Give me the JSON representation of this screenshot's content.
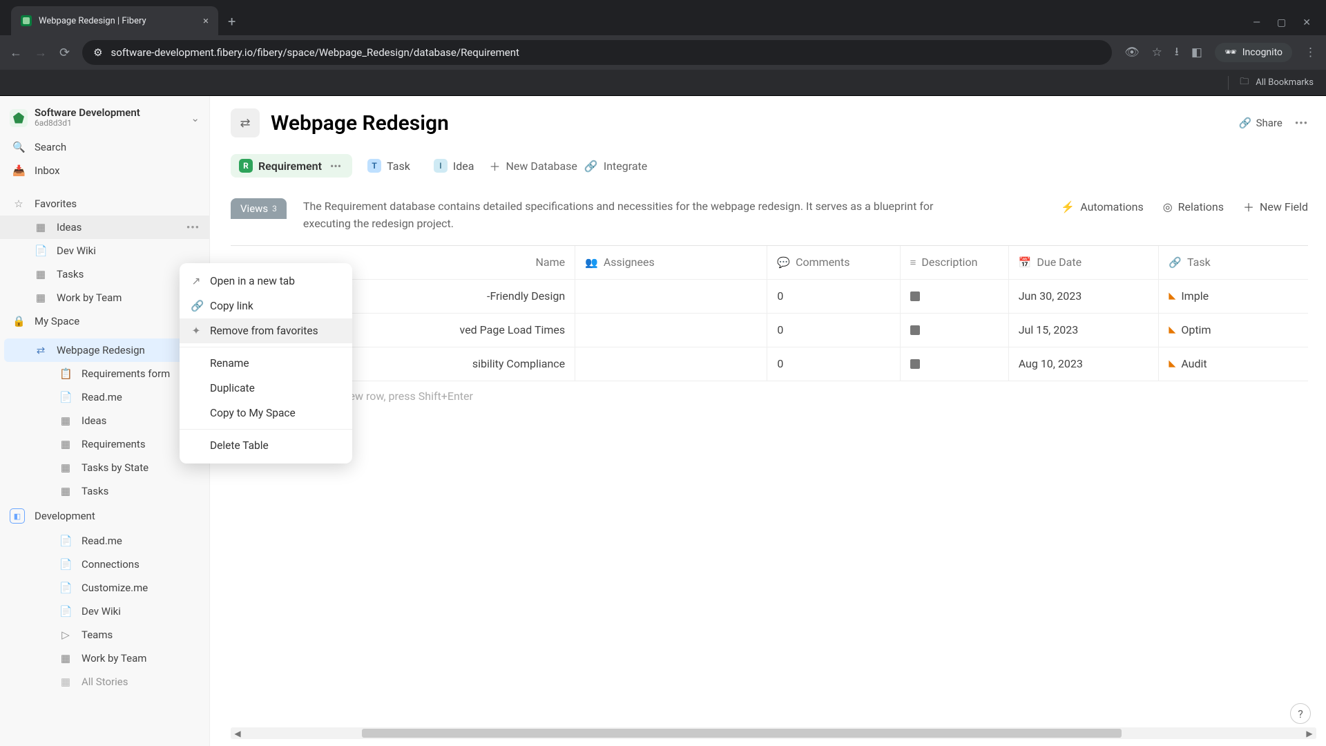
{
  "browser": {
    "tab_title": "Webpage Redesign | Fibery",
    "url": "software-development.fibery.io/fibery/space/Webpage_Redesign/database/Requirement",
    "incognito_label": "Incognito",
    "bookmarks_label": "All Bookmarks"
  },
  "workspace": {
    "name": "Software Development",
    "id": "6ad8d3d1"
  },
  "sidebar": {
    "search": "Search",
    "inbox": "Inbox",
    "favorites": "Favorites",
    "fav_items": [
      "Ideas",
      "Dev Wiki",
      "Tasks",
      "Work by Team"
    ],
    "myspace": "My Space",
    "spaces": [
      {
        "name": "Webpage Redesign",
        "items": [
          "Requirements form",
          "Read.me",
          "Ideas",
          "Requirements",
          "Tasks by State",
          "Tasks"
        ],
        "active": true
      },
      {
        "name": "Development",
        "items": [
          "Read.me",
          "Connections",
          "Customize.me",
          "Dev Wiki",
          "Teams",
          "Work by Team",
          "All Stories"
        ]
      }
    ]
  },
  "page": {
    "title": "Webpage Redesign",
    "share": "Share",
    "db_tabs": {
      "requirement": "Requirement",
      "task": "Task",
      "idea": "Idea",
      "newdb": "New Database",
      "integrate": "Integrate"
    },
    "views_label": "Views",
    "views_count": "3",
    "description": "The Requirement database contains detailed specifications and necessities for the webpage redesign. It serves as a blueprint for executing the redesign project.",
    "tools": {
      "automations": "Automations",
      "relations": "Relations",
      "newfield": "New Field"
    }
  },
  "table": {
    "columns": {
      "name": "Name",
      "assignees": "Assignees",
      "comments": "Comments",
      "description": "Description",
      "due": "Due Date",
      "task": "Task"
    },
    "rows": [
      {
        "name": "-Friendly Design",
        "comments": "0",
        "due": "Jun 30, 2023",
        "task": "Imple"
      },
      {
        "name": "ved Page Load Times",
        "comments": "0",
        "due": "Jul 15, 2023",
        "task": "Optim"
      },
      {
        "name": "sibility Compliance",
        "comments": "0",
        "due": "Aug 10, 2023",
        "task": "Audit"
      }
    ],
    "newrow": "a new row, press Shift+Enter"
  },
  "context_menu": {
    "open": "Open in a new tab",
    "copy": "Copy link",
    "remove": "Remove from favorites",
    "rename": "Rename",
    "duplicate": "Duplicate",
    "copyto": "Copy to My Space",
    "delete": "Delete Table"
  }
}
